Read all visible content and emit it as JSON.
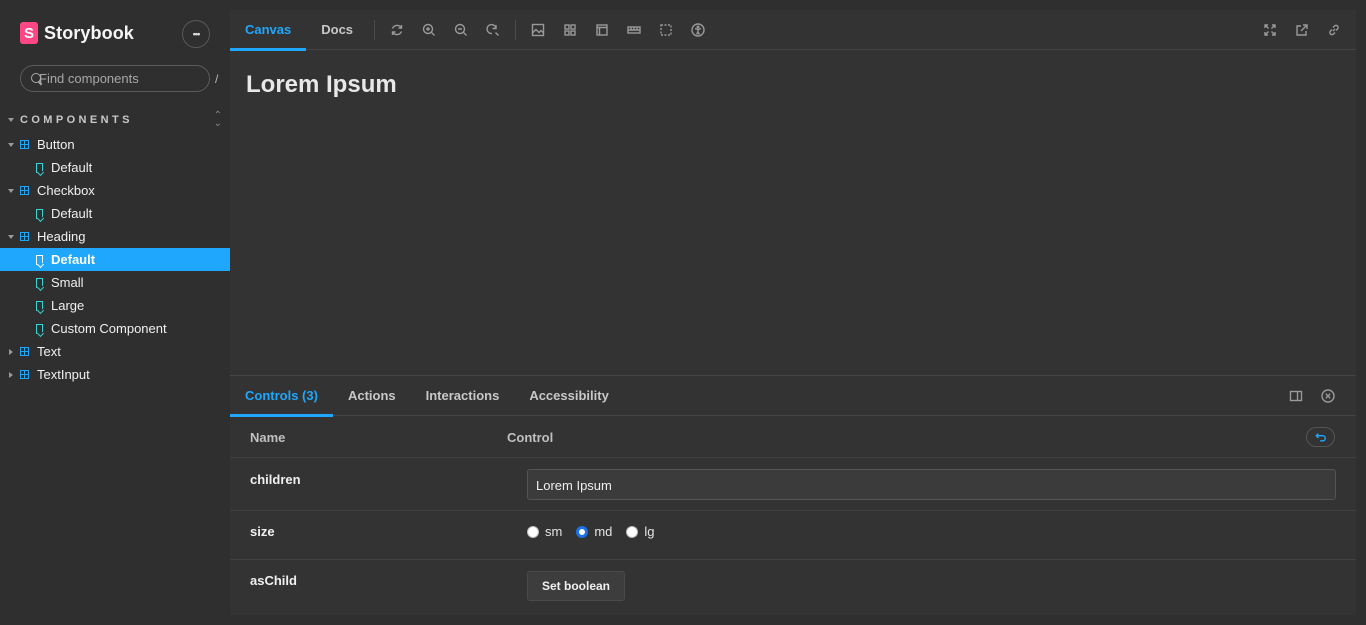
{
  "brand": {
    "logo_letter": "S",
    "name": "Storybook"
  },
  "sidebar": {
    "menu_glyph": "•••",
    "search": {
      "placeholder": "Find components",
      "shortcut": "/"
    },
    "section_title": "COMPONENTS",
    "tree": [
      {
        "kind": "component",
        "label": "Button",
        "expanded": true
      },
      {
        "kind": "story",
        "label": "Default",
        "selected": false
      },
      {
        "kind": "component",
        "label": "Checkbox",
        "expanded": true
      },
      {
        "kind": "story",
        "label": "Default",
        "selected": false
      },
      {
        "kind": "component",
        "label": "Heading",
        "expanded": true
      },
      {
        "kind": "story",
        "label": "Default",
        "selected": true
      },
      {
        "kind": "story",
        "label": "Small",
        "selected": false
      },
      {
        "kind": "story",
        "label": "Large",
        "selected": false
      },
      {
        "kind": "story",
        "label": "Custom Component",
        "selected": false
      },
      {
        "kind": "component",
        "label": "Text",
        "expanded": false
      },
      {
        "kind": "component",
        "label": "TextInput",
        "expanded": false
      }
    ]
  },
  "toolbar": {
    "tabs": [
      {
        "label": "Canvas",
        "active": true
      },
      {
        "label": "Docs",
        "active": false
      }
    ]
  },
  "canvas": {
    "heading": "Lorem Ipsum"
  },
  "addons": {
    "tabs": [
      {
        "label": "Controls (3)",
        "active": true
      },
      {
        "label": "Actions",
        "active": false
      },
      {
        "label": "Interactions",
        "active": false
      },
      {
        "label": "Accessibility",
        "active": false
      }
    ],
    "table": {
      "name_header": "Name",
      "control_header": "Control",
      "rows": {
        "children": {
          "name": "children",
          "value": "Lorem Ipsum"
        },
        "size": {
          "name": "size",
          "options": [
            "sm",
            "md",
            "lg"
          ],
          "selected": "md"
        },
        "aschild": {
          "name": "asChild",
          "button_label": "Set boolean"
        }
      }
    }
  },
  "colors": {
    "accent": "#1ea7fd",
    "brand": "#ff4785",
    "story_icon": "#37d5d3",
    "background": "#2f2f2f"
  }
}
